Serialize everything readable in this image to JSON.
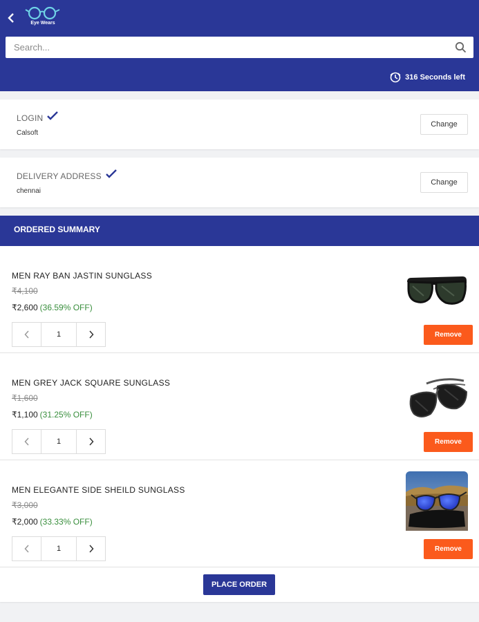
{
  "header": {
    "back_icon": "chevron-left-icon",
    "logo_text": "Eye Wears",
    "brand_color": "#2a3797"
  },
  "search": {
    "placeholder": "Search...",
    "value": "",
    "icon": "search-icon"
  },
  "timer": {
    "icon": "timer-icon",
    "text": "316 Seconds left"
  },
  "login": {
    "title": "LOGIN",
    "value": "Calsoft",
    "change_label": "Change"
  },
  "delivery": {
    "title": "DELIVERY ADDRESS",
    "value": "chennai",
    "change_label": "Change"
  },
  "summary": {
    "title": "ORDERED SUMMARY"
  },
  "items": [
    {
      "name": "MEN RAY BAN JASTIN SUNGLASS",
      "mrp": "₹4,100",
      "price": "₹2,600",
      "off": "(36.59% OFF)",
      "qty": "1",
      "remove_label": "Remove",
      "image": "wayfarer-sunglasses-image"
    },
    {
      "name": "MEN GREY JACK SQUARE SUNGLASS",
      "mrp": "₹1,600",
      "price": "₹1,100",
      "off": "(31.25% OFF)",
      "qty": "1",
      "remove_label": "Remove",
      "image": "aviator-sunglasses-image"
    },
    {
      "name": "MEN ELEGANTE SIDE SHEILD SUNGLASS",
      "mrp": "₹3,000",
      "price": "₹2,000",
      "off": "(33.33% OFF)",
      "qty": "1",
      "remove_label": "Remove",
      "image": "blue-lens-sunglasses-photo"
    }
  ],
  "footer": {
    "place_order_label": "PLACE ORDER"
  },
  "colors": {
    "primary": "#2a3797",
    "remove": "#fb5a1c",
    "discount": "#388e3c"
  }
}
